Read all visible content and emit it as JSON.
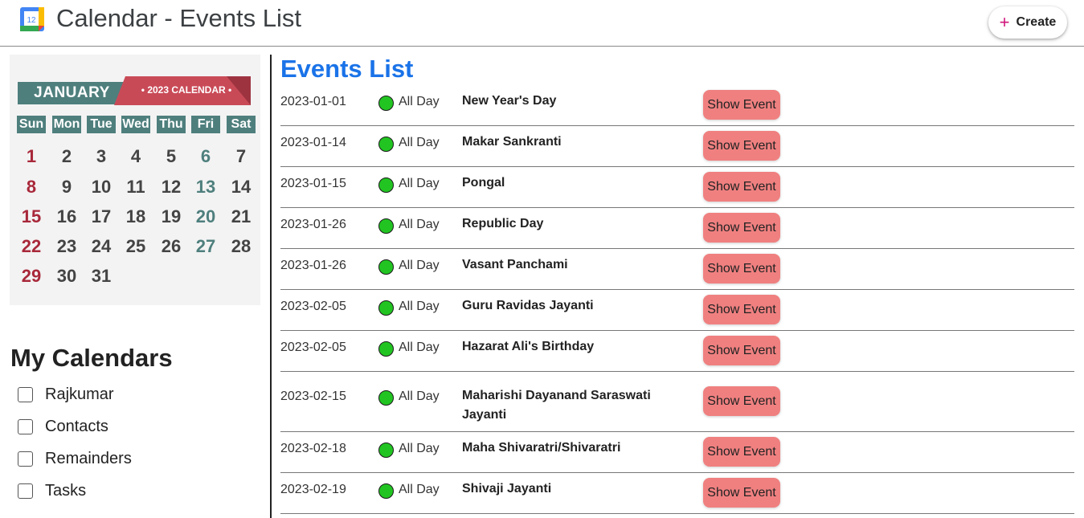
{
  "header": {
    "title": "Calendar - Events List",
    "app_icon_number": "12",
    "create_label": "Create"
  },
  "mini_calendar": {
    "month": "JANUARY",
    "year_label": "• 2023 CALENDAR •",
    "weekdays": [
      "Sun",
      "Mon",
      "Tue",
      "Wed",
      "Thu",
      "Fri",
      "Sat"
    ],
    "weeks": [
      [
        "1",
        "2",
        "3",
        "4",
        "5",
        "6",
        "7"
      ],
      [
        "8",
        "9",
        "10",
        "11",
        "12",
        "13",
        "14"
      ],
      [
        "15",
        "16",
        "17",
        "18",
        "19",
        "20",
        "21"
      ],
      [
        "22",
        "23",
        "24",
        "25",
        "26",
        "27",
        "28"
      ],
      [
        "29",
        "30",
        "31",
        "",
        "",
        "",
        ""
      ]
    ]
  },
  "my_calendars": {
    "title": "My Calendars",
    "items": [
      {
        "label": "Rajkumar",
        "checked": false
      },
      {
        "label": "Contacts",
        "checked": false
      },
      {
        "label": "Remainders",
        "checked": false
      },
      {
        "label": "Tasks",
        "checked": false
      }
    ]
  },
  "events": {
    "title": "Events List",
    "button_label": "Show Event",
    "status_color": "#22c422",
    "rows": [
      {
        "date": "2023-01-01",
        "time": "All Day",
        "name": "New Year's Day"
      },
      {
        "date": "2023-01-14",
        "time": "All Day",
        "name": "Makar Sankranti"
      },
      {
        "date": "2023-01-15",
        "time": "All Day",
        "name": "Pongal"
      },
      {
        "date": "2023-01-26",
        "time": "All Day",
        "name": "Republic Day"
      },
      {
        "date": "2023-01-26",
        "time": "All Day",
        "name": "Vasant Panchami"
      },
      {
        "date": "2023-02-05",
        "time": "All Day",
        "name": "Guru Ravidas Jayanti"
      },
      {
        "date": "2023-02-05",
        "time": "All Day",
        "name": "Hazarat Ali's Birthday"
      },
      {
        "date": "2023-02-15",
        "time": "All Day",
        "name": "Maharishi Dayanand Saraswati Jayanti"
      },
      {
        "date": "2023-02-18",
        "time": "All Day",
        "name": "Maha Shivaratri/Shivaratri"
      },
      {
        "date": "2023-02-19",
        "time": "All Day",
        "name": "Shivaji Jayanti"
      }
    ]
  }
}
